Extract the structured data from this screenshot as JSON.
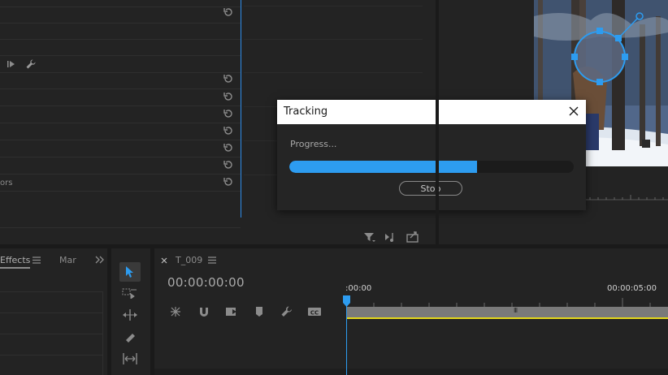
{
  "effect_controls": {
    "partial_label": "ors",
    "reset_icon": "reset-icon",
    "wrench_icon": "wrench-icon",
    "play_icon": "play-to-icon"
  },
  "program_monitor": {
    "footer_icons": [
      "filter-export-icon",
      "insert-icon",
      "export-frame-icon"
    ]
  },
  "dialog": {
    "title": "Tracking",
    "progress_label": "Progress...",
    "progress_fraction": 0.66,
    "stop_label": "Stop",
    "accent": "#2d9cf0"
  },
  "effects_panel": {
    "tab_effects": "Effects",
    "tab_markers": "Mar",
    "menu_icon": "hamburger-icon",
    "overflow_icon": "double-chevron-icon"
  },
  "tools": [
    "selection-tool-icon",
    "track-select-tool-icon",
    "ripple-edit-tool-icon",
    "razor-tool-icon",
    "slip-tool-icon"
  ],
  "timeline": {
    "sequence_name": "T_009",
    "timecode": "00:00:00:00",
    "ruler_start": ":00:00",
    "ruler_mark": "00:00:05:00",
    "clip_marker": "III",
    "playhead_color": "#2d9cf0",
    "work_area_color": "#e5d81b"
  }
}
